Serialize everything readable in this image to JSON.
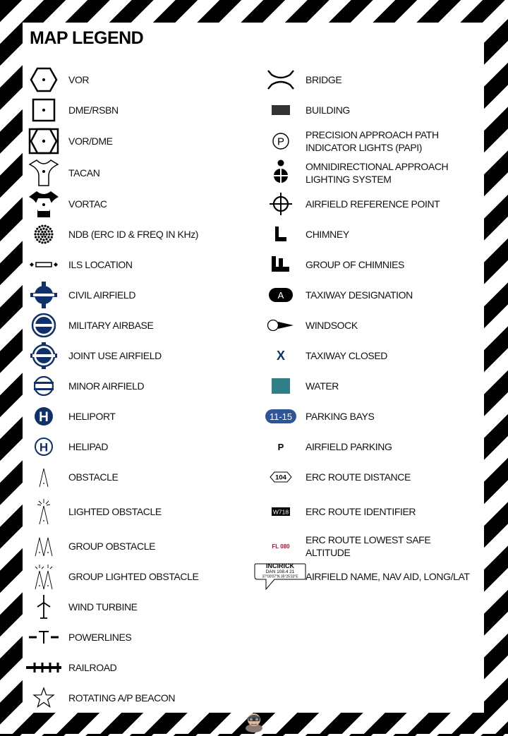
{
  "title": "MAP LEGEND",
  "left": [
    {
      "label": "VOR",
      "icon": "vor-icon"
    },
    {
      "label": "DME/RSBN",
      "icon": "dme-rsbn-icon"
    },
    {
      "label": "VOR/DME",
      "icon": "vor-dme-icon"
    },
    {
      "label": "TACAN",
      "icon": "tacan-icon"
    },
    {
      "label": "VORTAC",
      "icon": "vortac-icon"
    },
    {
      "label": "NDB (ERC ID & FREQ IN KHz)",
      "icon": "ndb-icon"
    },
    {
      "label": "ILS LOCATION",
      "icon": "ils-location-icon"
    },
    {
      "label": "CIVIL AIRFIELD",
      "icon": "civil-airfield-icon"
    },
    {
      "label": "MILITARY AIRBASE",
      "icon": "military-airbase-icon"
    },
    {
      "label": "JOINT USE AIRFIELD",
      "icon": "joint-use-airfield-icon"
    },
    {
      "label": "MINOR AIRFIELD",
      "icon": "minor-airfield-icon"
    },
    {
      "label": "HELIPORT",
      "icon": "heliport-icon"
    },
    {
      "label": "HELIPAD",
      "icon": "helipad-icon"
    },
    {
      "label": "OBSTACLE",
      "icon": "obstacle-icon"
    },
    {
      "label": "LIGHTED OBSTACLE",
      "icon": "lighted-obstacle-icon"
    },
    {
      "label": "GROUP OBSTACLE",
      "icon": "group-obstacle-icon"
    },
    {
      "label": "GROUP LIGHTED OBSTACLE",
      "icon": "group-lighted-obstacle-icon"
    },
    {
      "label": "WIND TURBINE",
      "icon": "wind-turbine-icon"
    },
    {
      "label": "POWERLINES",
      "icon": "powerlines-icon"
    },
    {
      "label": "RAILROAD",
      "icon": "railroad-icon"
    },
    {
      "label": "ROTATING A/P BEACON",
      "icon": "rotating-beacon-icon"
    }
  ],
  "right": [
    {
      "label": "BRIDGE",
      "icon": "bridge-icon"
    },
    {
      "label": "BUILDING",
      "icon": "building-icon"
    },
    {
      "label": "PRECISION APPROACH PATH INDICATOR LIGHTS (PAPI)",
      "icon": "papi-icon",
      "glyph": "P"
    },
    {
      "label": "OMNIDIRECTIONAL APPROACH LIGHTING SYSTEM",
      "icon": "odals-icon"
    },
    {
      "label": "AIRFIELD REFERENCE POINT",
      "icon": "airfield-reference-point-icon"
    },
    {
      "label": "CHIMNEY",
      "icon": "chimney-icon"
    },
    {
      "label": "GROUP OF CHIMNIES",
      "icon": "group-chimneys-icon"
    },
    {
      "label": "TAXIWAY DESIGNATION",
      "icon": "taxiway-designation-icon",
      "glyph": "A"
    },
    {
      "label": "WINDSOCK",
      "icon": "windsock-icon"
    },
    {
      "label": "TAXIWAY CLOSED",
      "icon": "taxiway-closed-icon",
      "glyph": "X"
    },
    {
      "label": "WATER",
      "icon": "water-icon"
    },
    {
      "label": "PARKING BAYS",
      "icon": "parking-bays-icon",
      "glyph": "11-15"
    },
    {
      "label": "AIRFIELD PARKING",
      "icon": "airfield-parking-icon",
      "glyph": "P"
    },
    {
      "label": "ERC ROUTE DISTANCE",
      "icon": "erc-route-distance-icon",
      "glyph": "104"
    },
    {
      "label": "ERC ROUTE IDENTIFIER",
      "icon": "erc-route-identifier-icon",
      "glyph": "W718"
    },
    {
      "label": "ERC ROUTE LOWEST SAFE ALTITUDE",
      "icon": "erc-lowest-safe-altitude-icon",
      "glyph": "FL 080"
    },
    {
      "label": "AIRFIELD NAME, NAV AID, LONG/LAT",
      "icon": "airfield-name-callout-icon",
      "glyph": {
        "name": "INCIRICK",
        "navaid": "DAN 108.4 21",
        "coords": "37°00'07\"N  35°25'33\"E"
      }
    }
  ],
  "colors": {
    "navy": "#10306b",
    "water": "#2f7f88",
    "parking": "#2d5597",
    "red": "#b01030",
    "stripe": "#000000"
  }
}
